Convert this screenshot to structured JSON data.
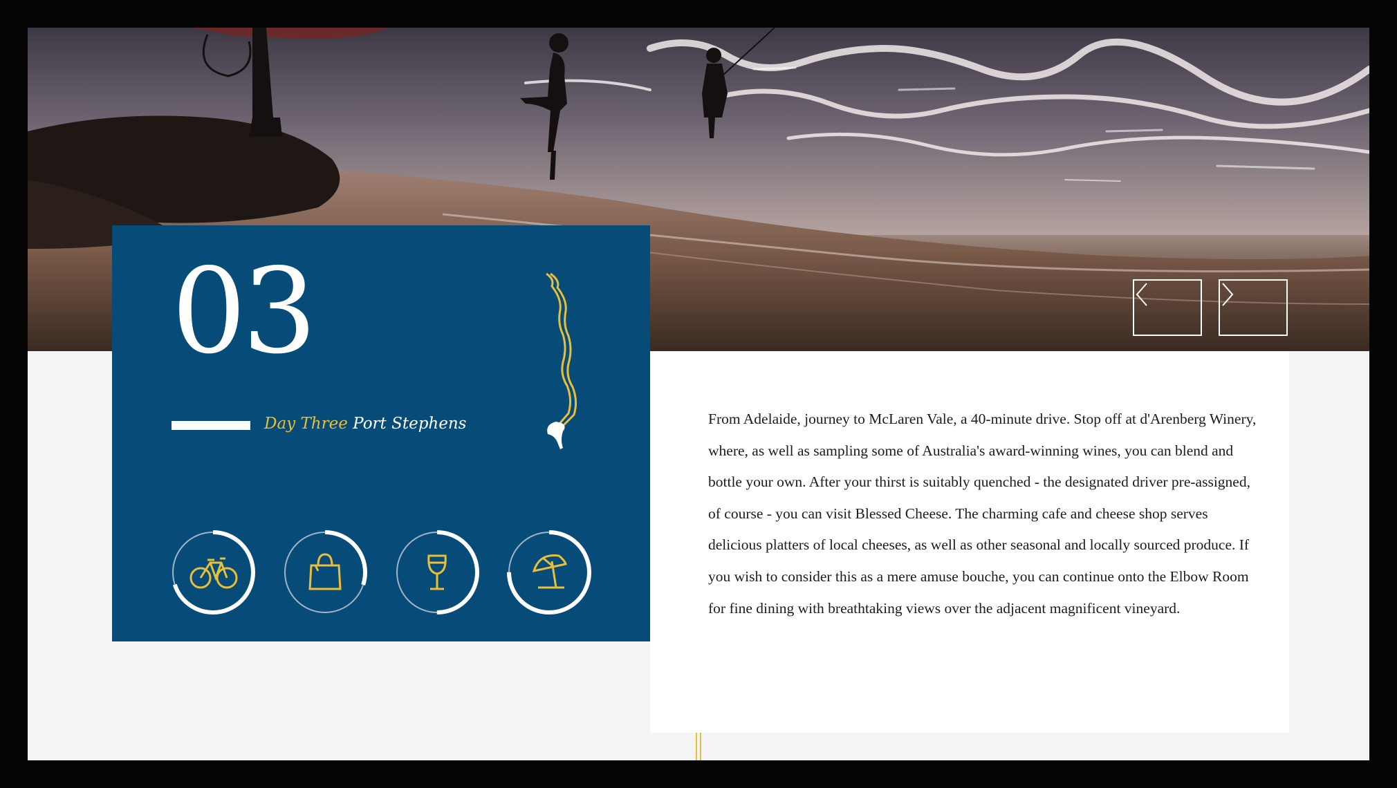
{
  "itinerary": {
    "day_number": "03",
    "day_label": "Day Three",
    "place_name": "Port Stephens",
    "description": "From Adelaide, journey to McLaren Vale, a 40-minute drive. Stop off at d'Arenberg Winery, where, as well as sampling some of Australia's award-winning wines, you can blend and bottle your own.  After your thirst is suitably quenched - the designated driver pre-assigned, of course - you can visit Blessed Cheese. The charming cafe and cheese shop serves delicious platters of local cheeses, as well as other seasonal and locally sourced produce. If you wish to consider this as a mere amuse bouche, you can continue onto the Elbow Room for fine dining with breathtaking views over the adjacent magnificent vineyard.",
    "activities": [
      {
        "icon": "bicycle-icon",
        "progress": 0.7
      },
      {
        "icon": "shopping-bag-icon",
        "progress": 0.3
      },
      {
        "icon": "wine-glass-icon",
        "progress": 0.5
      },
      {
        "icon": "beach-umbrella-icon",
        "progress": 0.75
      }
    ]
  },
  "gallery": {
    "prev_icon": "chevron-left-icon",
    "next_icon": "chevron-right-icon"
  },
  "colors": {
    "card_background": "#074c79",
    "accent_gold": "#e9bf3a",
    "page_background": "#f4f4f4",
    "panel_background": "#ffffff"
  }
}
